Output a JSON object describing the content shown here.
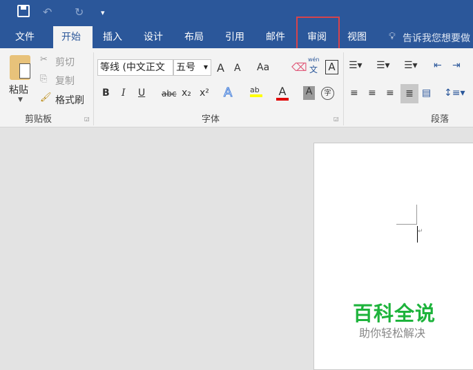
{
  "qat": {
    "save": "save-icon",
    "undo": "↶",
    "redo": "↻",
    "customize": "▾"
  },
  "tabs": [
    "文件",
    "开始",
    "插入",
    "设计",
    "布局",
    "引用",
    "邮件",
    "审阅",
    "视图"
  ],
  "tell_me": "告诉我您想要做",
  "clipboard": {
    "paste": "粘贴",
    "cut": "剪切",
    "copy": "复制",
    "format_painter": "格式刷",
    "group": "剪贴板"
  },
  "font": {
    "name": "等线 (中文正文",
    "size": "五号",
    "grow": "A",
    "shrink": "A",
    "case": "Aa",
    "phonetic_top": "wén",
    "phonetic": "文",
    "border": "A",
    "bold": "B",
    "italic": "I",
    "underline": "U",
    "strike": "abc",
    "sub": "x₂",
    "sup": "x²",
    "effects": "A",
    "highlight": "ab",
    "color": "A",
    "shading": "A",
    "enclose": "字",
    "group": "字体"
  },
  "paragraph": {
    "group": "段落"
  },
  "colors": {
    "brand": "#2b579a",
    "highlight": "#ffff00",
    "font_color": "#e00000",
    "watermark": "#1db33b"
  },
  "watermark": {
    "title": "百科全说",
    "subtitle": "助你轻松解决"
  },
  "doc": {
    "para_mark": "↵"
  }
}
